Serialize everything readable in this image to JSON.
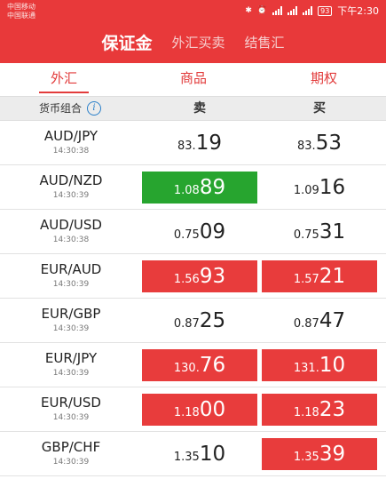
{
  "status_bar": {
    "carrier1": "中国移动",
    "carrier2": "中国联通",
    "battery": "93",
    "time": "下午2:30"
  },
  "nav": {
    "tabs": [
      "保证金",
      "外汇买卖",
      "结售汇"
    ]
  },
  "sub_tabs": [
    "外汇",
    "商品",
    "期权"
  ],
  "columns": {
    "pair": "货币组合",
    "sell": "卖",
    "buy": "买"
  },
  "colors": {
    "header": "#e8393a",
    "up_red": "#e83c3c",
    "down_green": "#27a52f"
  },
  "quotes": [
    {
      "pair": "AUD/JPY",
      "time": "14:30:38",
      "sell": {
        "small": "83.",
        "big": "19",
        "color": "none"
      },
      "buy": {
        "small": "83.",
        "big": "53",
        "color": "none"
      }
    },
    {
      "pair": "AUD/NZD",
      "time": "14:30:39",
      "sell": {
        "small": "1.08",
        "big": "89",
        "color": "green"
      },
      "buy": {
        "small": "1.09",
        "big": "16",
        "color": "none"
      }
    },
    {
      "pair": "AUD/USD",
      "time": "14:30:38",
      "sell": {
        "small": "0.75",
        "big": "09",
        "color": "none"
      },
      "buy": {
        "small": "0.75",
        "big": "31",
        "color": "none"
      }
    },
    {
      "pair": "EUR/AUD",
      "time": "14:30:39",
      "sell": {
        "small": "1.56",
        "big": "93",
        "color": "red"
      },
      "buy": {
        "small": "1.57",
        "big": "21",
        "color": "red"
      }
    },
    {
      "pair": "EUR/GBP",
      "time": "14:30:39",
      "sell": {
        "small": "0.87",
        "big": "25",
        "color": "none"
      },
      "buy": {
        "small": "0.87",
        "big": "47",
        "color": "none"
      }
    },
    {
      "pair": "EUR/JPY",
      "time": "14:30:39",
      "sell": {
        "small": "130.",
        "big": "76",
        "color": "red"
      },
      "buy": {
        "small": "131.",
        "big": "10",
        "color": "red"
      }
    },
    {
      "pair": "EUR/USD",
      "time": "14:30:39",
      "sell": {
        "small": "1.18",
        "big": "00",
        "color": "red"
      },
      "buy": {
        "small": "1.18",
        "big": "23",
        "color": "red"
      }
    },
    {
      "pair": "GBP/CHF",
      "time": "14:30:39",
      "sell": {
        "small": "1.35",
        "big": "10",
        "color": "none"
      },
      "buy": {
        "small": "1.35",
        "big": "39",
        "color": "red"
      }
    }
  ]
}
